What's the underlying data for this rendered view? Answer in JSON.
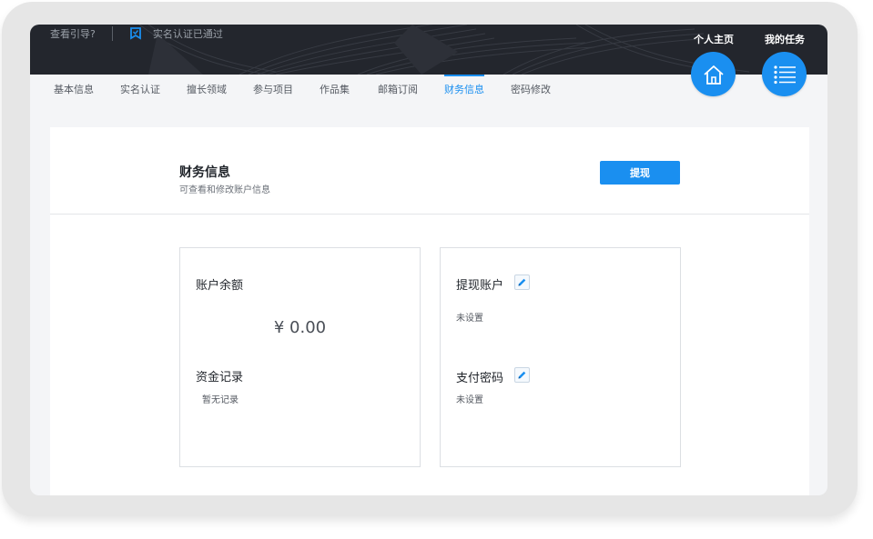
{
  "banner": {
    "help_text": "查看引导?",
    "verified_text": "实名认证已通过",
    "home_label": "个人主页",
    "tasks_label": "我的任务"
  },
  "tabs": [
    {
      "label": "基本信息"
    },
    {
      "label": "实名认证"
    },
    {
      "label": "擅长领域"
    },
    {
      "label": "参与项目"
    },
    {
      "label": "作品集"
    },
    {
      "label": "邮箱订阅"
    },
    {
      "label": "财务信息",
      "active": true
    },
    {
      "label": "密码修改"
    }
  ],
  "finance": {
    "title": "财务信息",
    "subtitle": "可查看和修改账户信息",
    "withdraw_label": "提现",
    "balance_label": "账户余额",
    "balance_value": "¥ 0.00",
    "records_label": "资金记录",
    "records_empty": "暂无记录",
    "withdraw_account_label": "提现账户",
    "withdraw_account_value": "未设置",
    "pay_password_label": "支付密码",
    "pay_password_value": "未设置"
  },
  "colors": {
    "accent": "#1a8ff0",
    "banner_bg": "#23262d",
    "page_bg": "#f4f5f7"
  },
  "icons": {
    "home": "home-icon",
    "tasks": "list-icon",
    "verified": "verified-badge-icon",
    "edit": "pencil-icon"
  }
}
